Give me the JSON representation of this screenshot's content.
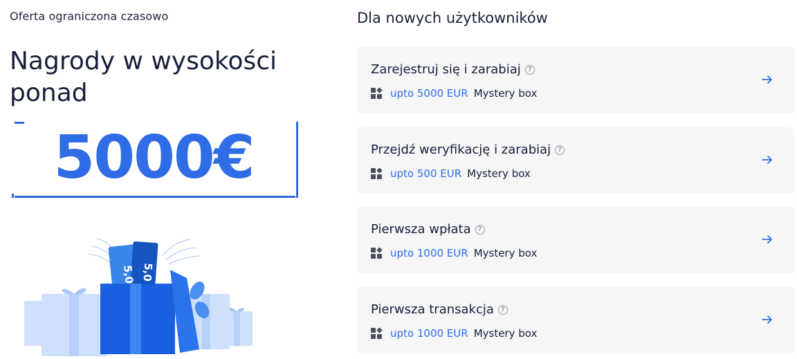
{
  "promo": {
    "eyebrow": "Oferta ograniczona czasowo",
    "headline": "Nagrody w wysokości ponad",
    "amount": "5000€",
    "illustration_label": "5,0",
    "illustration_label_2": "5,0"
  },
  "tasks_section": {
    "title": "Dla nowych użytkowników",
    "items": [
      {
        "title": "Zarejestruj się i zarabiaj",
        "reward_amount": "upto 5000 EUR",
        "reward_type": "Mystery box",
        "help_icon": "question-circle-icon",
        "arrow_icon": "arrow-right-icon"
      },
      {
        "title": "Przejdź weryfikację i zarabiaj",
        "reward_amount": "upto 500 EUR",
        "reward_type": "Mystery box",
        "help_icon": "question-circle-icon",
        "arrow_icon": "arrow-right-icon"
      },
      {
        "title": "Pierwsza wpłata",
        "reward_amount": "upto 1000 EUR",
        "reward_type": "Mystery box",
        "help_icon": "question-circle-icon",
        "arrow_icon": "arrow-right-icon"
      },
      {
        "title": "Pierwsza transakcja",
        "reward_amount": "upto 1000 EUR",
        "reward_type": "Mystery box",
        "help_icon": "question-circle-icon",
        "arrow_icon": "arrow-right-icon"
      }
    ]
  },
  "colors": {
    "accent_blue": "#2f6de6",
    "text_dark": "#17203a",
    "card_bg": "#f6f6f7"
  }
}
